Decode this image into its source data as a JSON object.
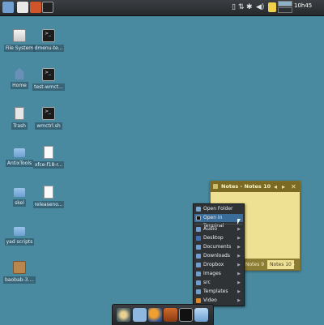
{
  "panel": {
    "clock": "10h45",
    "tray_icons": [
      "drive-icon",
      "network-icon",
      "bluetooth-icon",
      "volume-icon",
      "notes-tray-icon"
    ]
  },
  "desktop": {
    "icons": [
      {
        "label": "File System",
        "icon": "drive-icon"
      },
      {
        "label": "dmenu-te...",
        "icon": "terminal-icon"
      },
      {
        "label": "Home",
        "icon": "home-icon"
      },
      {
        "label": "test-wmct...",
        "icon": "terminal-icon"
      },
      {
        "label": "Trash",
        "icon": "trash-icon"
      },
      {
        "label": "wmctrl.sh",
        "icon": "terminal-icon"
      },
      {
        "label": "AntixTools",
        "icon": "folder-icon"
      },
      {
        "label": "xfce-f18-r...",
        "icon": "document-icon"
      },
      {
        "label": "skel",
        "icon": "folder-icon"
      },
      {
        "label": "releaseno...",
        "icon": "document-icon"
      },
      {
        "label": "yad scripts",
        "icon": "folder-icon"
      },
      {
        "label": "baobab-3....",
        "icon": "package-icon"
      }
    ]
  },
  "notes": {
    "title": "Notes - Notes 10",
    "tabs": [
      "Notes 9",
      "Notes 10"
    ],
    "active_tab": "Notes 10"
  },
  "context_menu": {
    "items": [
      {
        "label": "Open Folder",
        "icon": "folder-open-icon",
        "submenu": false
      },
      {
        "label": "Open in Terminal",
        "icon": "terminal-icon",
        "submenu": false,
        "highlighted": true
      },
      {
        "label": "Audio",
        "icon": "audio-folder-icon",
        "submenu": true
      },
      {
        "label": "Desktop",
        "icon": "desktop-folder-icon",
        "submenu": true
      },
      {
        "label": "Documents",
        "icon": "documents-folder-icon",
        "submenu": true
      },
      {
        "label": "Downloads",
        "icon": "downloads-folder-icon",
        "submenu": true
      },
      {
        "label": "Dropbox",
        "icon": "dropbox-folder-icon",
        "submenu": true
      },
      {
        "label": "Images",
        "icon": "images-folder-icon",
        "submenu": true
      },
      {
        "label": "src",
        "icon": "folder-icon",
        "submenu": true
      },
      {
        "label": "Templates",
        "icon": "templates-folder-icon",
        "submenu": true
      },
      {
        "label": "Video",
        "icon": "video-folder-icon",
        "submenu": true
      }
    ]
  },
  "dock": {
    "items": [
      "screenshot-icon",
      "file-manager-icon",
      "firefox-icon",
      "settings-icon",
      "terminal-icon",
      "home-folder-icon"
    ]
  },
  "colors": {
    "desktop_bg": "#4a8aa0",
    "menu_highlight": "#3b6d9a",
    "note_yellow": "#efe193"
  }
}
